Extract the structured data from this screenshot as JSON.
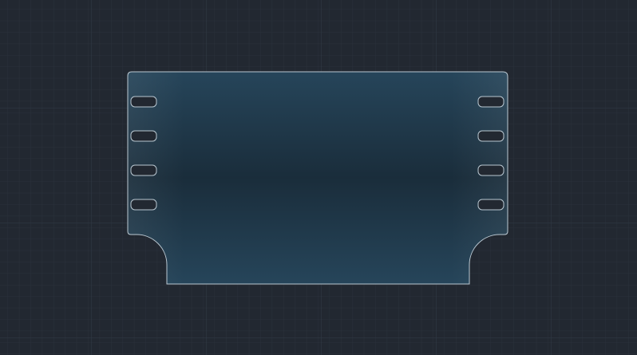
{
  "canvas": {
    "background_color": "#222831",
    "grid_minor_color": "#2a313b",
    "grid_major_color": "#323b47"
  },
  "part": {
    "name": "panel-with-side-slots-and-corner-reliefs",
    "fill_edge_color": "#26455a",
    "fill_center_color": "#1a2d3b",
    "outline_color": "#b9c7d1",
    "left_slot_count": 4,
    "right_slot_count": 4
  }
}
